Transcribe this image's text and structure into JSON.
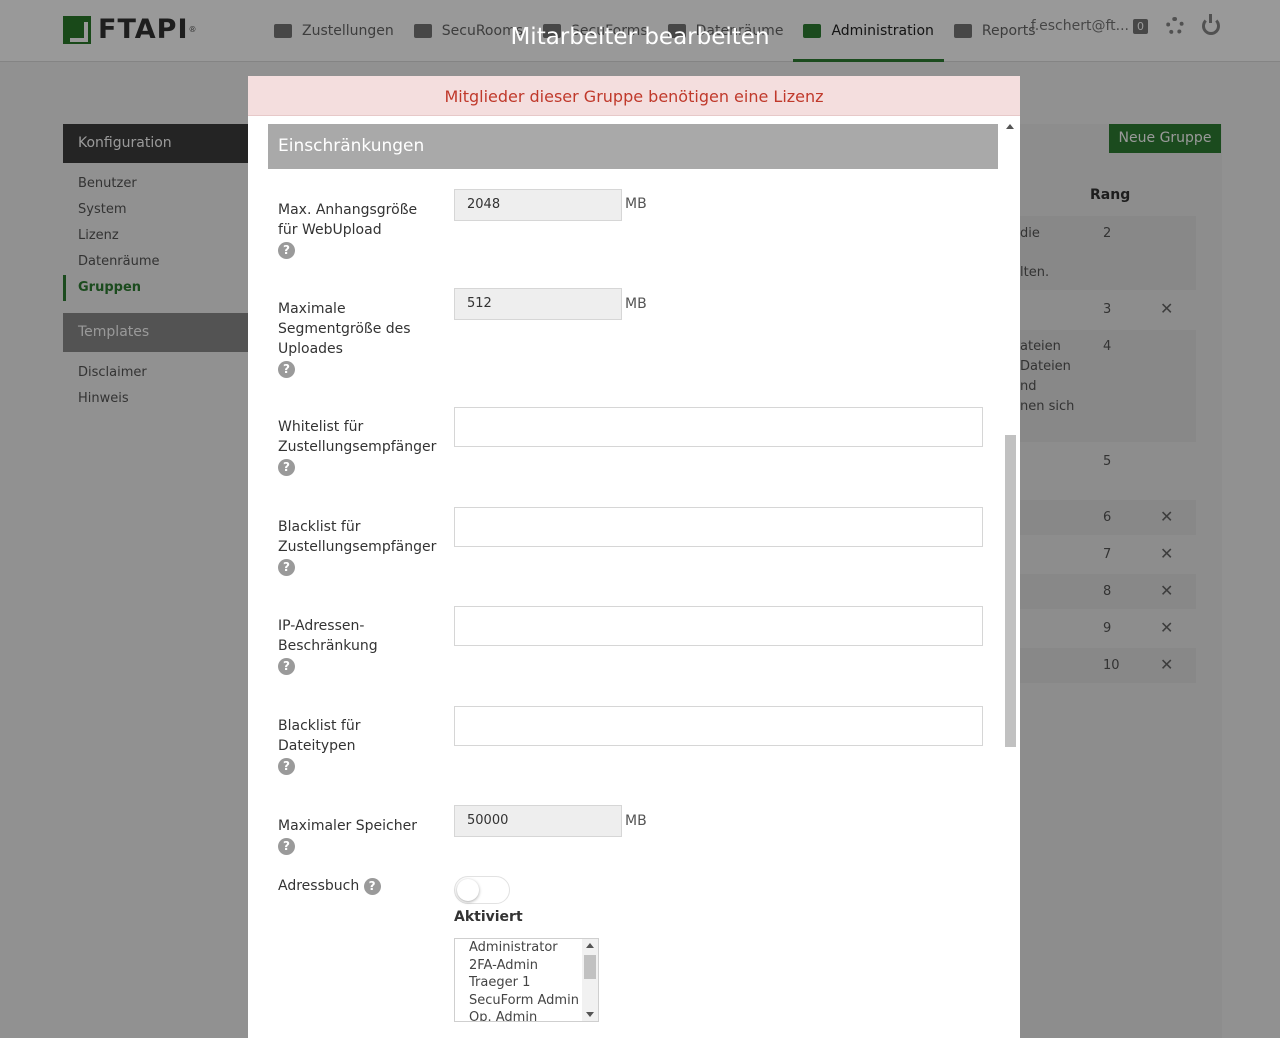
{
  "brand": {
    "name": "FTAPI",
    "reg": "®"
  },
  "nav": {
    "items": [
      {
        "label": "Zustellungen",
        "icon": "envelope-icon"
      },
      {
        "label": "SecuRooms",
        "icon": "cloud-icon"
      },
      {
        "label": "SecuForms",
        "icon": "forms-icon"
      },
      {
        "label": "Datenräume",
        "icon": "folder-icon"
      },
      {
        "label": "Administration",
        "icon": "briefcase-icon"
      },
      {
        "label": "Reports",
        "icon": "list-icon"
      }
    ],
    "active_index": 4,
    "user": "f.eschert@ft...",
    "notification_count": "0"
  },
  "sidebar": {
    "config_title": "Konfiguration",
    "config_items": [
      "Benutzer",
      "System",
      "Lizenz",
      "Datenräume",
      "Gruppen"
    ],
    "active_item": "Gruppen",
    "templates_title": "Templates",
    "templates_items": [
      "Disclaimer",
      "Hinweis"
    ]
  },
  "background": {
    "new_group_button": "Neue Gruppe",
    "rank_header": "Rang",
    "rows": [
      {
        "frag1": "die",
        "frag2": "lten.",
        "rank": "2",
        "deletable": false
      },
      {
        "frag1": "",
        "rank": "3",
        "deletable": true
      },
      {
        "frag1": "ateien",
        "frag2": "Dateien",
        "frag3": "nd",
        "frag4": "nen sich",
        "rank": "4",
        "deletable": false
      },
      {
        "frag1": "",
        "rank": "5",
        "deletable": false
      },
      {
        "frag1": "",
        "rank": "6",
        "deletable": true
      },
      {
        "frag1": "",
        "rank": "7",
        "deletable": true
      },
      {
        "frag1": "",
        "rank": "8",
        "deletable": true
      },
      {
        "frag1": "",
        "rank": "9",
        "deletable": true
      },
      {
        "frag1": "",
        "rank": "10",
        "deletable": true
      }
    ]
  },
  "modal": {
    "title": "Mitarbeiter bearbeiten",
    "alert": "Mitglieder dieser Gruppe benötigen eine Lizenz",
    "section": "Einschränkungen",
    "help_glyph": "?",
    "unit": "MB",
    "fields": {
      "max_attachment": {
        "label_1": "Max. Anhangsgröße",
        "label_2": "für WebUpload",
        "value": "2048"
      },
      "max_segment": {
        "label_1": "Maximale",
        "label_2": "Segmentgröße des",
        "label_3": "Uploades",
        "value": "512"
      },
      "whitelist": {
        "label_1": "Whitelist für",
        "label_2": "Zustellungsempfänger",
        "value": ""
      },
      "blacklist": {
        "label_1": "Blacklist für",
        "label_2": "Zustellungsempfänger",
        "value": ""
      },
      "ip_restriction": {
        "label_1": "IP-Adressen-",
        "label_2": "Beschränkung",
        "value": ""
      },
      "filetype_blacklist": {
        "label_1": "Blacklist für",
        "label_2": "Dateitypen",
        "value": ""
      },
      "max_storage": {
        "label_1": "Maximaler Speicher",
        "value": "50000"
      }
    },
    "addressbook": {
      "label": "Adressbuch",
      "toggle_on": false,
      "toggle_caption": "Aktiviert",
      "options": [
        "Administrator",
        "2FA-Admin",
        "Traeger 1",
        "SecuForm Admin",
        "Op. Admin"
      ]
    }
  }
}
